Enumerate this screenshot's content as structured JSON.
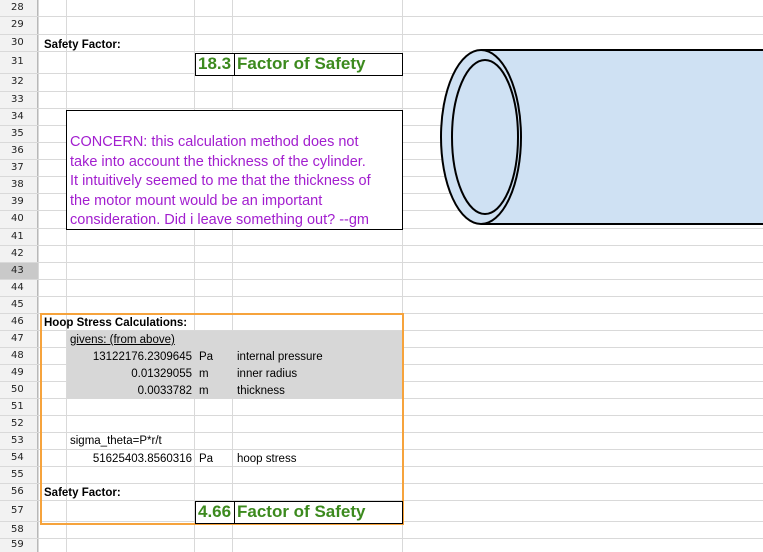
{
  "rows": [
    "28",
    "29",
    "30",
    "31",
    "32",
    "33",
    "34",
    "35",
    "36",
    "37",
    "38",
    "39",
    "40",
    "41",
    "42",
    "43",
    "44",
    "45",
    "46",
    "47",
    "48",
    "49",
    "50",
    "51",
    "52",
    "53",
    "54",
    "55",
    "56",
    "57",
    "58",
    "59"
  ],
  "selected_row": "43",
  "section1": {
    "heading": "Safety Factor:",
    "value": "18.3",
    "label": "Factor of Safety"
  },
  "concern_lines": [
    "CONCERN: this calculation method does not",
    "take into account the thickness of the cylinder.",
    "It intuitively seemed to me that the thickness of",
    "the motor mount would be an important",
    "consideration. Did i leave something out? --gm"
  ],
  "hoop": {
    "heading": "Hoop Stress Calculations:",
    "givens_label": "givens: (from above)",
    "givens": [
      {
        "value": "13122176.2309645",
        "unit": "Pa",
        "desc": "internal pressure"
      },
      {
        "value": "0.01329055",
        "unit": "m",
        "desc": "inner radius"
      },
      {
        "value": "0.0033782",
        "unit": "m",
        "desc": "thickness"
      }
    ],
    "formula": "sigma_theta=P*r/t",
    "result": {
      "value": "51625403.8560316",
      "unit": "Pa",
      "desc": "hoop stress"
    }
  },
  "section2": {
    "heading": "Safety Factor:",
    "value": "4.66",
    "label": "Factor of Safety"
  },
  "colors": {
    "green": "#3c8a1e",
    "purple": "#a21ecf",
    "orange": "#f6a33c",
    "cylinder_fill": "#cfe1f3"
  }
}
